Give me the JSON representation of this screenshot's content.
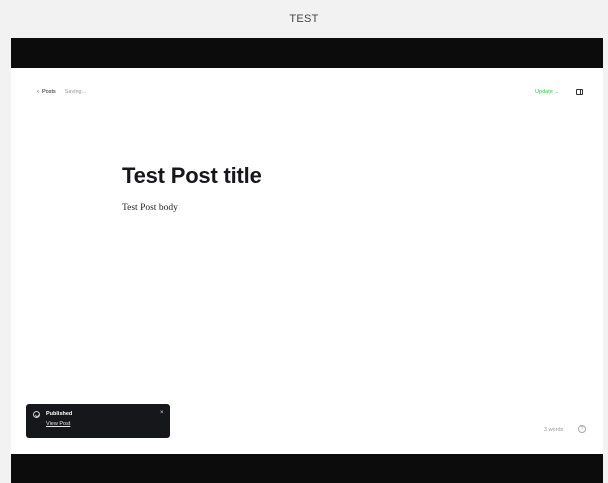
{
  "page": {
    "caption": "TEST"
  },
  "header": {
    "back_label": "Posts",
    "back_icon": "chevron-left-icon",
    "saving_status": "Saving...",
    "update_label": "Update",
    "update_icon": "chevron-down-icon",
    "sidebar_toggle_icon": "sidebar-icon"
  },
  "post": {
    "title": "Test Post title",
    "body": "Test Post body"
  },
  "toast": {
    "icon": "check-circle-icon",
    "title": "Published",
    "link_label": "View Post",
    "close_label": "×"
  },
  "footer": {
    "word_count": "3 words",
    "help_label": "?"
  },
  "colors": {
    "accent_green": "#30cf43",
    "bar_dark": "#0c0c0c",
    "toast_bg": "#15171a",
    "title_text": "#15171a"
  }
}
